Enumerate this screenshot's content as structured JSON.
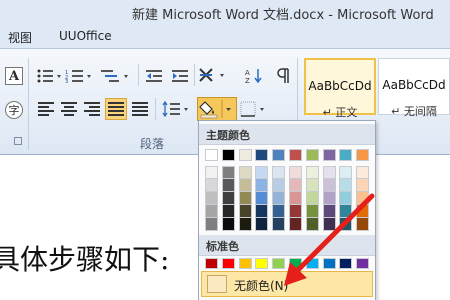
{
  "window": {
    "title": "新建 Microsoft Word 文档.docx  -  Microsoft Word"
  },
  "tabs": [
    "视图",
    "UUOffice"
  ],
  "ribbon": {
    "paragraph_group_label": "段落",
    "styles": [
      {
        "sample": "AaBbCcDd",
        "name": "↵ 正文"
      },
      {
        "sample": "AaBbCcDd",
        "name": "↵ 无间隔"
      }
    ]
  },
  "color_menu": {
    "theme_header": "主题颜色",
    "standard_header": "标准色",
    "no_color_label": "无颜色(N)",
    "theme_colors": [
      [
        "#ffffff",
        "#000000",
        "#eeece1",
        "#1f497d",
        "#4f81bd",
        "#c0504d",
        "#9bbb59",
        "#8064a2",
        "#4bacc6",
        "#f79646"
      ],
      [
        "#f2f2f2",
        "#7f7f7f",
        "#ddd9c3",
        "#c6d9f0",
        "#dbe5f1",
        "#f2dcdb",
        "#ebf1dd",
        "#e5e0ec",
        "#dbeef3",
        "#fdeada"
      ],
      [
        "#d8d8d8",
        "#595959",
        "#c4bd97",
        "#8db3e2",
        "#b8cce4",
        "#e5b9b7",
        "#d7e3bc",
        "#ccc1d9",
        "#b7dde8",
        "#fbd5b5"
      ],
      [
        "#bfbfbf",
        "#3f3f3f",
        "#938953",
        "#548dd4",
        "#95b3d7",
        "#d99694",
        "#c3d69b",
        "#b2a2c7",
        "#92cddc",
        "#fac08f"
      ],
      [
        "#a5a5a5",
        "#262626",
        "#494429",
        "#17365d",
        "#366092",
        "#953734",
        "#76923c",
        "#5f497a",
        "#31859b",
        "#e36c09"
      ],
      [
        "#7f7f7f",
        "#0c0c0c",
        "#1d1b10",
        "#0f243e",
        "#244061",
        "#632423",
        "#4f6128",
        "#3f3151",
        "#205867",
        "#974806"
      ]
    ],
    "standard_colors": [
      "#c00000",
      "#ff0000",
      "#ffc000",
      "#ffff00",
      "#92d050",
      "#00b050",
      "#00b0f0",
      "#0070c0",
      "#002060",
      "#7030a0"
    ]
  },
  "document": {
    "text": "具体步骤如下:"
  },
  "colors": {
    "arrow": "#e5201b",
    "highlight": "#fde7a6",
    "ribbon_bg": "#dfe8f5"
  }
}
